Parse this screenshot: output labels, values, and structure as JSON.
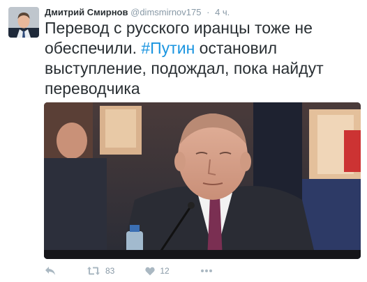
{
  "tweet": {
    "author_name": "Дмитрий Смирнов",
    "author_handle": "@dimsmirnov175",
    "separator": "·",
    "time_ago": "4 ч.",
    "text_before": "Перевод с русского иранцы тоже не обеспечили. ",
    "hashtag": "#Путин",
    "text_after": " остановил выступление, подождал, пока найдут переводчика"
  },
  "actions": {
    "retweet_count": "83",
    "like_count": "12"
  },
  "icons": {
    "reply": "reply-icon",
    "retweet": "retweet-icon",
    "like": "heart-icon",
    "more": "more-icon"
  },
  "colors": {
    "hashtag": "#1b95e0",
    "muted": "#8899a6",
    "icon": "#aab8c2"
  }
}
